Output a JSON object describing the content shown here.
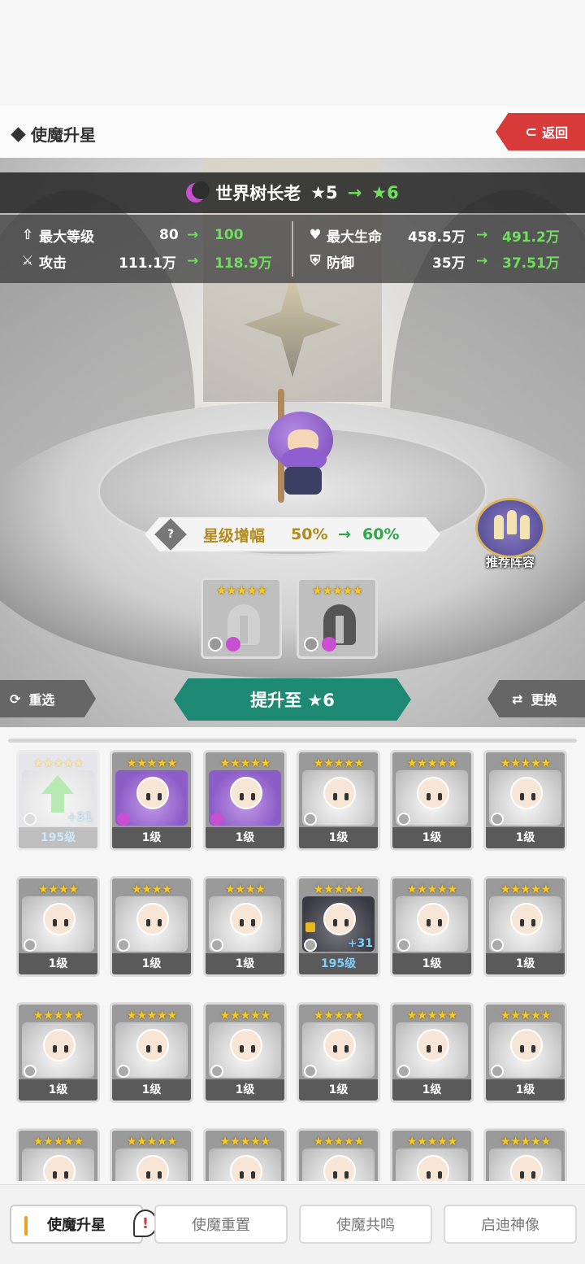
{
  "header": {
    "title": "使魔升星",
    "back_label": "返回"
  },
  "hero": {
    "name": "世界树长老",
    "star_from": "★5",
    "arrow": "→",
    "star_to": "★6",
    "element": "moon"
  },
  "stats": [
    {
      "icon": "arrow-up-icon",
      "label": "最大等级",
      "from": "80",
      "to": "100"
    },
    {
      "icon": "sword-icon",
      "label": "攻击",
      "from": "111.1万",
      "to": "118.9万"
    },
    {
      "icon": "heart-icon",
      "label": "最大生命",
      "from": "458.5万",
      "to": "491.2万"
    },
    {
      "icon": "shield-icon",
      "label": "防御",
      "from": "35万",
      "to": "37.51万"
    }
  ],
  "star_bonus": {
    "label": "星级增幅",
    "from": "50%",
    "to": "60%",
    "help": "?"
  },
  "recommend_label": "推荐阵容",
  "material_slots": [
    {
      "stars": "★★★★★"
    },
    {
      "stars": "★★★★★"
    }
  ],
  "buttons": {
    "reselect": "重选",
    "upgrade": "提升至 ★6",
    "swap": "更换"
  },
  "cards": [
    {
      "stars": "★★★★★",
      "level": "195级",
      "plus": "+31",
      "style": "selected"
    },
    {
      "stars": "★★★★★",
      "level": "1级",
      "style": "purple",
      "moon": true
    },
    {
      "stars": "★★★★★",
      "level": "1级",
      "style": "purple",
      "moon": true
    },
    {
      "stars": "★★★★★",
      "level": "1级"
    },
    {
      "stars": "★★★★★",
      "level": "1级"
    },
    {
      "stars": "★★★★★",
      "level": "1级"
    },
    {
      "stars": "★★★★",
      "level": "1级"
    },
    {
      "stars": "★★★★",
      "level": "1级"
    },
    {
      "stars": "★★★★",
      "level": "1级"
    },
    {
      "stars": "★★★★★",
      "level": "195级",
      "plus": "+31",
      "locked": true
    },
    {
      "stars": "★★★★★",
      "level": "1级"
    },
    {
      "stars": "★★★★★",
      "level": "1级"
    },
    {
      "stars": "★★★★★",
      "level": "1级"
    },
    {
      "stars": "★★★★★",
      "level": "1级"
    },
    {
      "stars": "★★★★★",
      "level": "1级"
    },
    {
      "stars": "★★★★★",
      "level": "1级"
    },
    {
      "stars": "★★★★★",
      "level": "1级"
    },
    {
      "stars": "★★★★★",
      "level": "1级"
    },
    {
      "stars": "★★★★★",
      "level": ""
    },
    {
      "stars": "★★★★★",
      "level": ""
    },
    {
      "stars": "★★★★★",
      "level": ""
    },
    {
      "stars": "★★★★★",
      "level": ""
    },
    {
      "stars": "★★★★★",
      "level": ""
    },
    {
      "stars": "★★★★★",
      "level": ""
    }
  ],
  "tabs": [
    {
      "label": "使魔升星",
      "active": true,
      "badge": "!"
    },
    {
      "label": "使魔重置"
    },
    {
      "label": "使魔共鸣"
    },
    {
      "label": "启迪神像"
    }
  ],
  "colors": {
    "accent_green": "#1f8a73",
    "back_red": "#d83a3a",
    "gain_green": "#6ee05a",
    "bonus_gold": "#b08a1e"
  }
}
